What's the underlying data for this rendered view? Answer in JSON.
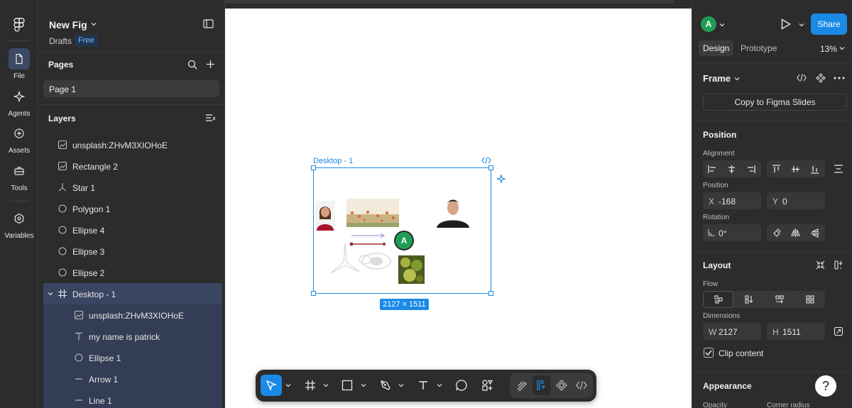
{
  "file": {
    "title": "New Fig",
    "location": "Drafts",
    "plan_badge": "Free"
  },
  "rail": {
    "items": [
      {
        "label": "File",
        "icon": "file-icon",
        "active": true
      },
      {
        "label": "Agents",
        "icon": "agents-icon"
      },
      {
        "label": "Assets",
        "icon": "assets-icon"
      },
      {
        "label": "Tools",
        "icon": "tools-icon"
      },
      {
        "label": "Variables",
        "icon": "variables-icon"
      }
    ]
  },
  "pages": {
    "header": "Pages",
    "items": [
      "Page 1"
    ]
  },
  "layers": {
    "header": "Layers",
    "items": [
      {
        "label": "unsplash:ZHvM3XIOHoE",
        "icon": "image-icon",
        "depth": 0
      },
      {
        "label": "Rectangle 2",
        "icon": "image-icon",
        "depth": 0
      },
      {
        "label": "Star 1",
        "icon": "star-icon",
        "depth": 0
      },
      {
        "label": "Polygon 1",
        "icon": "polygon-icon",
        "depth": 0
      },
      {
        "label": "Ellipse 4",
        "icon": "ellipse-icon",
        "depth": 0
      },
      {
        "label": "Ellipse 3",
        "icon": "ellipse-icon",
        "depth": 0
      },
      {
        "label": "Ellipse 2",
        "icon": "ellipse-icon",
        "depth": 0
      },
      {
        "label": "Desktop - 1",
        "icon": "frame-icon",
        "depth": 0,
        "selected": true
      },
      {
        "label": "unsplash:ZHvM3XIOHoE",
        "icon": "image-icon",
        "depth": 1
      },
      {
        "label": "my name is patrick",
        "icon": "text-icon",
        "depth": 1
      },
      {
        "label": "Ellipse 1",
        "icon": "ellipse-icon",
        "depth": 1
      },
      {
        "label": "Arrow 1",
        "icon": "line-icon",
        "depth": 1
      },
      {
        "label": "Line 1",
        "icon": "line-icon",
        "depth": 1
      }
    ]
  },
  "canvas": {
    "frame_label": "Desktop - 1",
    "dimension_badge": "2127 × 1511",
    "collaborator_initial": "A"
  },
  "right_panel": {
    "user_initial": "A",
    "share_label": "Share",
    "tabs": [
      "Design",
      "Prototype"
    ],
    "zoom": "13%",
    "selection_type": "Frame",
    "copy_to_slides": "Copy to Figma Slides",
    "position": {
      "header": "Position",
      "alignment_label": "Alignment",
      "position_label": "Position",
      "x_label": "X",
      "x_value": "-168",
      "y_label": "Y",
      "y_value": "0",
      "rotation_label": "Rotation",
      "rotation_value": "0°"
    },
    "layout": {
      "header": "Layout",
      "flow_label": "Flow",
      "dimensions_label": "Dimensions",
      "w_label": "W",
      "w_value": "2127",
      "h_label": "H",
      "h_value": "1511",
      "clip_content": "Clip content",
      "clip_checked": true
    },
    "appearance": {
      "header": "Appearance",
      "opacity_label": "Opacity",
      "corner_radius_label": "Corner radius"
    },
    "help": "?"
  },
  "colors": {
    "accent": "#1a8ae6",
    "panel": "#2c2c2c",
    "avatar": "#1f9d55"
  }
}
